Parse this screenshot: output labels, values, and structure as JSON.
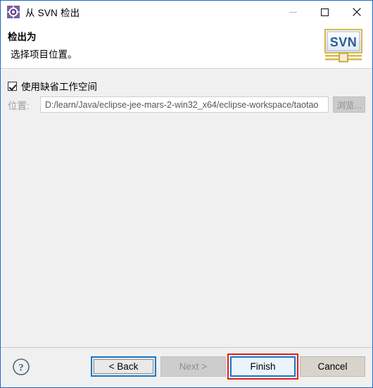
{
  "window": {
    "title": "从 SVN 检出",
    "icon": "svn-repository-icon",
    "border_color": "#1b6ac9",
    "controls": [
      {
        "name": "minimize-button",
        "glyph": "minimize-icon",
        "state": "dimmed"
      },
      {
        "name": "maximize-button",
        "glyph": "maximize-icon",
        "state": "normal"
      },
      {
        "name": "close-button",
        "glyph": "close-icon",
        "state": "normal"
      }
    ]
  },
  "header": {
    "title": "检出为",
    "description": "选择项目位置。",
    "logo_text": "SVN",
    "logo_name": "svn-banner-logo"
  },
  "form": {
    "use_default_workspace": {
      "label": "使用缺省工作空间",
      "checked": true
    },
    "location": {
      "label": "位置:",
      "value": "D:/learn/Java/eclipse-jee-mars-2-win32_x64/eclipse-workspace/taotao",
      "placeholder": "",
      "disabled": true
    },
    "browse_button": {
      "label": "浏览...",
      "disabled": true
    }
  },
  "footer": {
    "help_button": {
      "name": "help-button",
      "glyph": "question-mark-icon"
    },
    "buttons": [
      {
        "label": "< Back",
        "name": "back-button",
        "state": "focused"
      },
      {
        "label": "Next >",
        "name": "next-button",
        "state": "disabled"
      },
      {
        "label": "Finish",
        "name": "finish-button",
        "state": "default",
        "annotated": true
      },
      {
        "label": "Cancel",
        "name": "cancel-button",
        "state": "plain"
      }
    ]
  },
  "annotation": {
    "target": "finish-button",
    "color": "#e02020"
  }
}
